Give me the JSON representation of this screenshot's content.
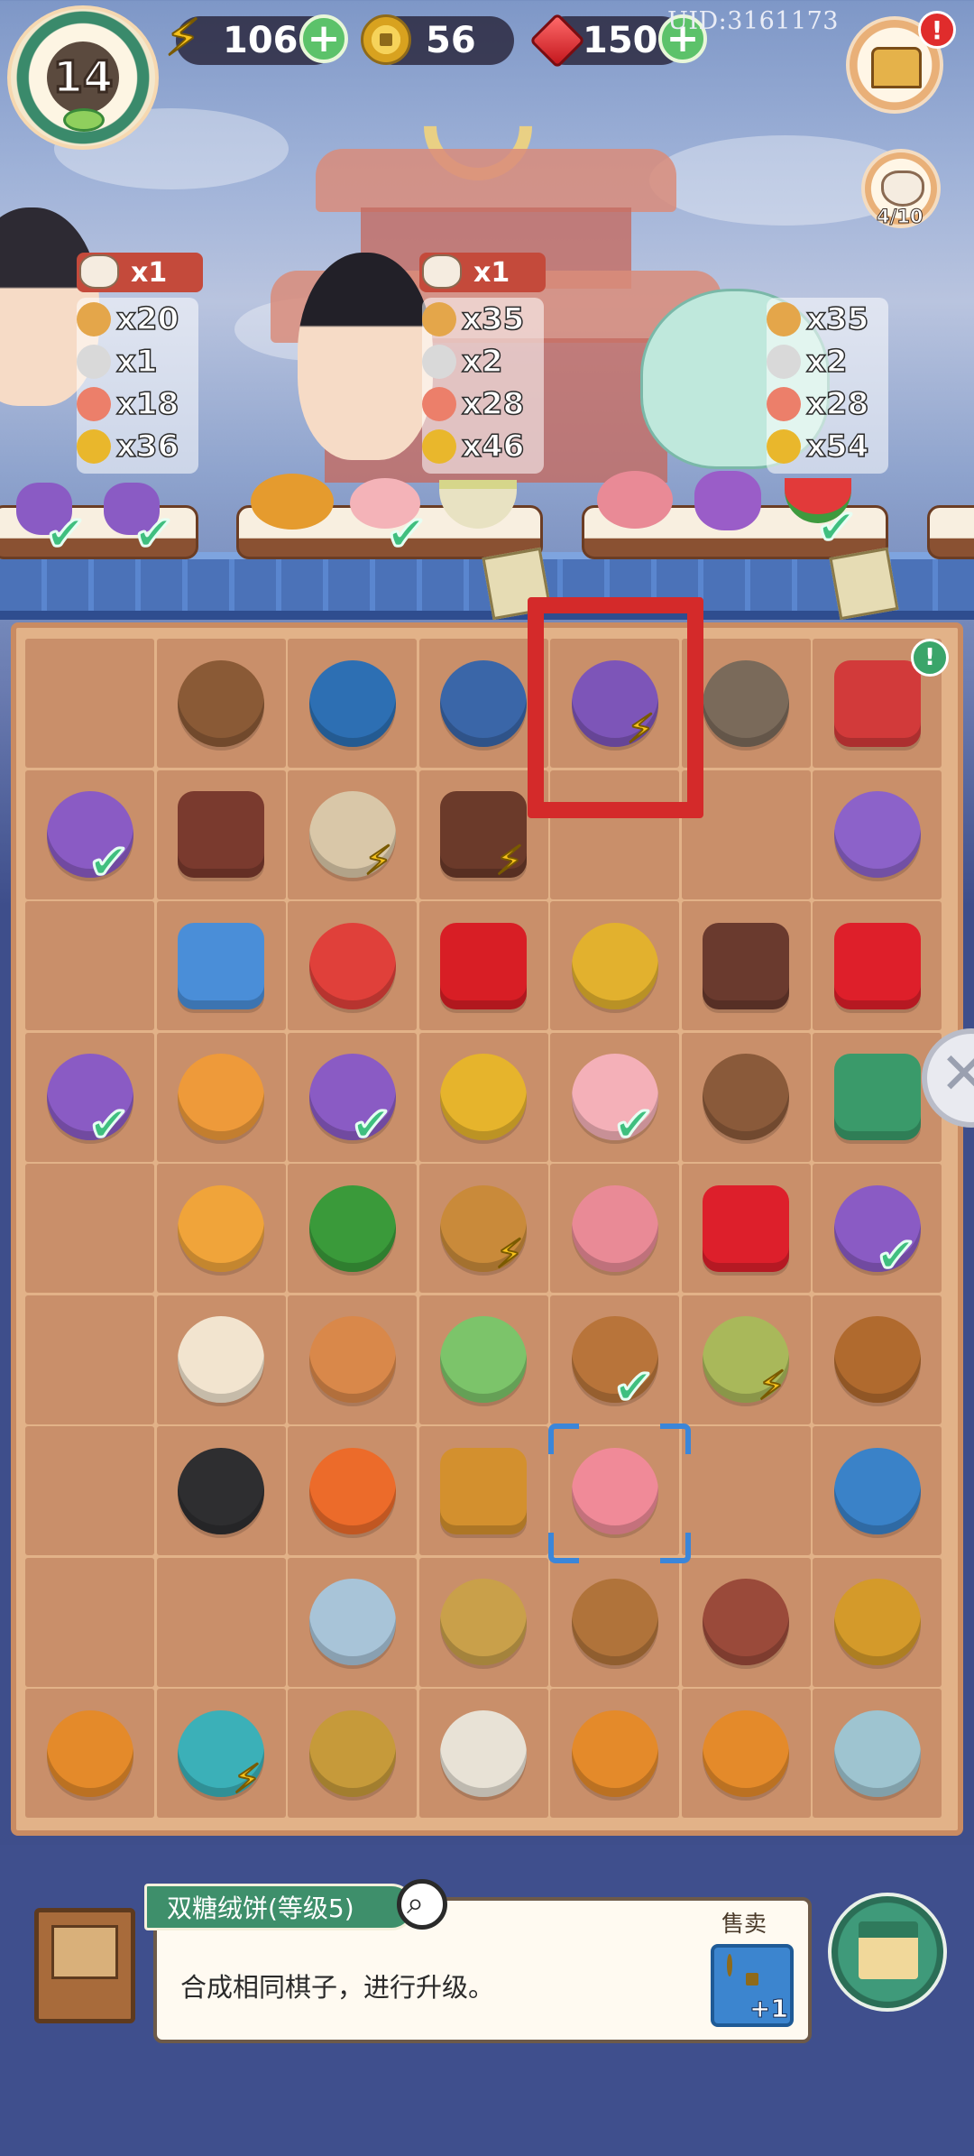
{
  "hud": {
    "level": "14",
    "energy": "106",
    "coins": "56",
    "gems": "150",
    "uid": "UID:3161173",
    "cat_count": "4/10"
  },
  "customers": [
    {
      "reward_tag": "x1",
      "orders": [
        {
          "icon": "mooncake",
          "count": "x20"
        },
        {
          "icon": "scissors",
          "count": "x1"
        },
        {
          "icon": "lotus",
          "count": "x18"
        },
        {
          "icon": "coin",
          "count": "x36"
        }
      ],
      "tray_items": [
        "purple-pouch",
        "purple-pouch"
      ]
    },
    {
      "reward_tag": "x1",
      "orders": [
        {
          "icon": "mooncake",
          "count": "x35"
        },
        {
          "icon": "scissors",
          "count": "x2"
        },
        {
          "icon": "lotus",
          "count": "x28"
        },
        {
          "icon": "coin",
          "count": "x46"
        }
      ],
      "tray_items": [
        "roast-chicken",
        "pink-cake",
        "soup-bowl"
      ]
    },
    {
      "reward_tag": "",
      "orders": [
        {
          "icon": "mooncake",
          "count": "x35"
        },
        {
          "icon": "scissors",
          "count": "x2"
        },
        {
          "icon": "lotus",
          "count": "x28"
        },
        {
          "icon": "coin",
          "count": "x54"
        }
      ],
      "tray_items": [
        "flower-cake",
        "purple-pouch",
        "watermelon-slices"
      ]
    }
  ],
  "board": {
    "rows": [
      [
        "",
        "sleeping-cat",
        "tea-cup",
        "tea-cup-blue",
        "gift-bundle",
        "tabby-cat",
        "red-tin"
      ],
      [
        "purple-pouch",
        "wooden-box",
        "silk-spool",
        "treasure-chest",
        "",
        "",
        "fabric-roll"
      ],
      [
        "",
        "blue-gem",
        "watermelon-slice",
        "red-gem",
        "gold-coin",
        "tray-box",
        "red-gems"
      ],
      [
        "purple-pouch",
        "fried-rice",
        "purple-pouch",
        "gold-flowers",
        "pink-cake",
        "bird-nest-egg",
        "green-tin"
      ],
      [
        "",
        "rooster-nest",
        "watermelon-half",
        "basket-cakes",
        "flower-cake",
        "red-gems-pile",
        "purple-pouch"
      ],
      [
        "",
        "bun-dumpling",
        "brown-egg",
        "scissors",
        "watermelon-board",
        "green-basket",
        "incense-pot"
      ],
      [
        "",
        "tuxedo-cat",
        "red-lantern",
        "wood-crate",
        "pink-cakes",
        "",
        "tea-pot-blue"
      ],
      [
        "",
        "",
        "feather",
        "brush",
        "bird-cage",
        "empty-nest",
        "bronze-censer"
      ],
      [
        "palace-lantern",
        "teapot",
        "brush-roll",
        "cotton-bolls",
        "palace-lantern",
        "palace-lantern",
        "jade-ring"
      ]
    ]
  },
  "selected_item": {
    "name": "双糖绒饼(等级5)",
    "description": "合成相同棋子，进行升级。",
    "sell_label": "售卖",
    "sell_value": "+1"
  }
}
